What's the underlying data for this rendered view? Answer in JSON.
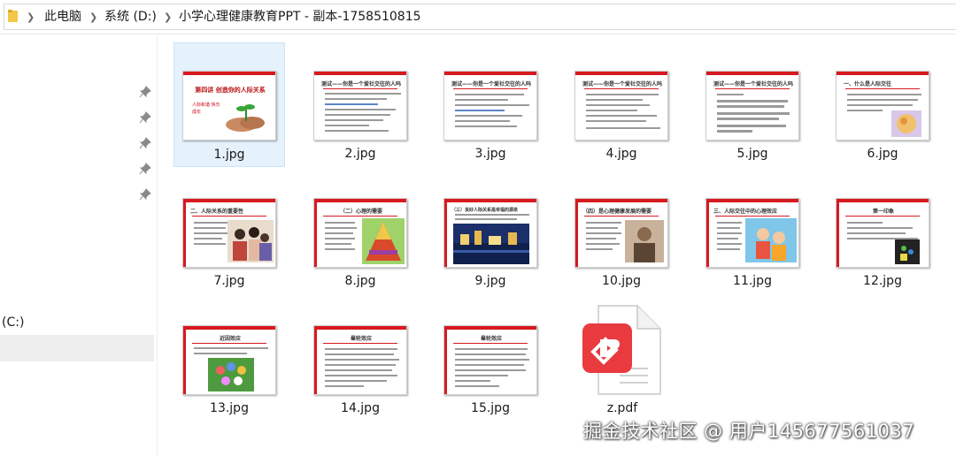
{
  "address_bar": {
    "crumbs": [
      "此电脑",
      "系统 (D:)",
      "小学心理健康教育PPT - 副本-1758510815"
    ]
  },
  "nav_pane": {
    "drive_label": "(C:)",
    "pinned_count": 5
  },
  "files": [
    {
      "name": "1.jpg",
      "slide_title": "第四讲 创造你的人际关系",
      "slide_caption": "人际和谐 快乐成长",
      "selected": true
    },
    {
      "name": "2.jpg",
      "slide_title": "测试——你是一个爱社交往的人吗？"
    },
    {
      "name": "3.jpg",
      "slide_title": "测试——你是一个爱社交往的人吗？"
    },
    {
      "name": "4.jpg",
      "slide_title": "测试——你是一个爱社交往的人吗？"
    },
    {
      "name": "5.jpg",
      "slide_title": "测试——你是一个爱社交往的人吗？"
    },
    {
      "name": "6.jpg",
      "slide_title": "一、什么是人际交往"
    },
    {
      "name": "7.jpg",
      "slide_title": "二、人际关系的重要性"
    },
    {
      "name": "8.jpg",
      "slide_title": "（二）心理的需要"
    },
    {
      "name": "9.jpg",
      "slide_title": "（三）良好人际关系是幸福的源泉"
    },
    {
      "name": "10.jpg",
      "slide_title": "（四）是心理健康发展的需要"
    },
    {
      "name": "11.jpg",
      "slide_title": "三、人际交往中的心理效应"
    },
    {
      "name": "12.jpg",
      "slide_title": "第一印象"
    },
    {
      "name": "13.jpg",
      "slide_title": "近因效应"
    },
    {
      "name": "14.jpg",
      "slide_title": "晕轮效应"
    },
    {
      "name": "15.jpg",
      "slide_title": "晕轮效应"
    },
    {
      "name": "z.pdf",
      "icon": "pdf-file-icon"
    }
  ],
  "colors": {
    "slide_accent": "#d71920",
    "selection_bg": "#e5f1fb",
    "pdf_red": "#e83a3f"
  },
  "watermark": "掘金技术社区 @ 用户145677561037"
}
